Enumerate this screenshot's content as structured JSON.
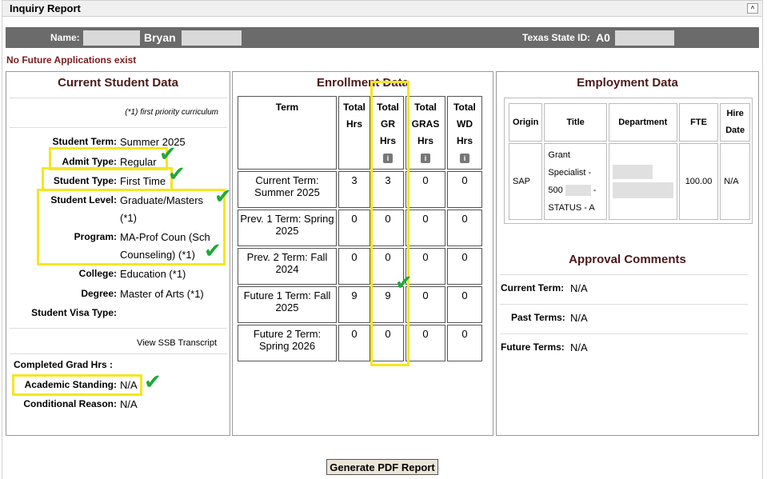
{
  "window": {
    "title": "Inquiry Report",
    "collapse_icon": "^"
  },
  "header": {
    "name_label": "Name:",
    "first_name": "Bryan",
    "state_id_label": "Texas State ID:",
    "state_id_prefix": "A0"
  },
  "notice": "No Future Applications exist",
  "student": {
    "title": "Current Student Data",
    "note": "(*1) first priority curriculum",
    "term_label": "Student Term:",
    "term": "Summer 2025",
    "admit_label": "Admit Type:",
    "admit": "Regular",
    "type_label": "Student Type:",
    "type": "First Time",
    "level_label": "Student Level:",
    "level_line1": "Graduate/Masters",
    "level_line2": "(*1)",
    "program_label": "Program:",
    "program_line1": "MA-Prof Coun (Sch",
    "program_line2": "Counseling) (*1)",
    "college_label": "College:",
    "college": "Education (*1)",
    "degree_label": "Degree:",
    "degree": "Master of Arts (*1)",
    "visa_label": "Student Visa Type:",
    "transcript_link": "View SSB Transcript",
    "completed_label": "Completed Grad Hrs :",
    "standing_label": "Academic Standing:",
    "standing": "N/A",
    "conditional_label": "Conditional Reason:",
    "conditional": "N/A"
  },
  "enrollment": {
    "title": "Enrollment Data",
    "headers": {
      "term": "Term",
      "total": "Total Hrs",
      "gr": "Total GR Hrs",
      "gras": "Total GRAS Hrs",
      "wd": "Total WD Hrs"
    },
    "info_icon": "i",
    "rows": [
      {
        "term": "Current Term: Summer 2025",
        "total": "3",
        "gr": "3",
        "gras": "0",
        "wd": "0"
      },
      {
        "term": "Prev. 1 Term: Spring 2025",
        "total": "0",
        "gr": "0",
        "gras": "0",
        "wd": "0"
      },
      {
        "term": "Prev. 2 Term: Fall 2024",
        "total": "0",
        "gr": "0",
        "gras": "0",
        "wd": "0"
      },
      {
        "term": "Future 1 Term: Fall 2025",
        "total": "9",
        "gr": "9",
        "gras": "0",
        "wd": "0"
      },
      {
        "term": "Future 2 Term: Spring 2026",
        "total": "0",
        "gr": "0",
        "gras": "0",
        "wd": "0"
      }
    ]
  },
  "employment": {
    "title": "Employment Data",
    "headers": {
      "origin": "Origin",
      "title": "Title",
      "department": "Department",
      "fte": "FTE",
      "hire": "Hire Date"
    },
    "row": {
      "origin": "SAP",
      "title1": "Grant",
      "title2": "Specialist -",
      "title3": "500",
      "title4": "-",
      "title5": "STATUS - A",
      "fte": "100.00",
      "hire": "N/A"
    }
  },
  "approval": {
    "title": "Approval Comments",
    "current_label": "Current Term:",
    "current": "N/A",
    "past_label": "Past Terms:",
    "past": "N/A",
    "future_label": "Future Terms:",
    "future": "N/A"
  },
  "actions": {
    "pdf_button": "Generate PDF Report"
  },
  "annotations": {
    "highlight_color": "#f5e61f",
    "check_color": "#1fa83a",
    "check_mark": "✔"
  }
}
